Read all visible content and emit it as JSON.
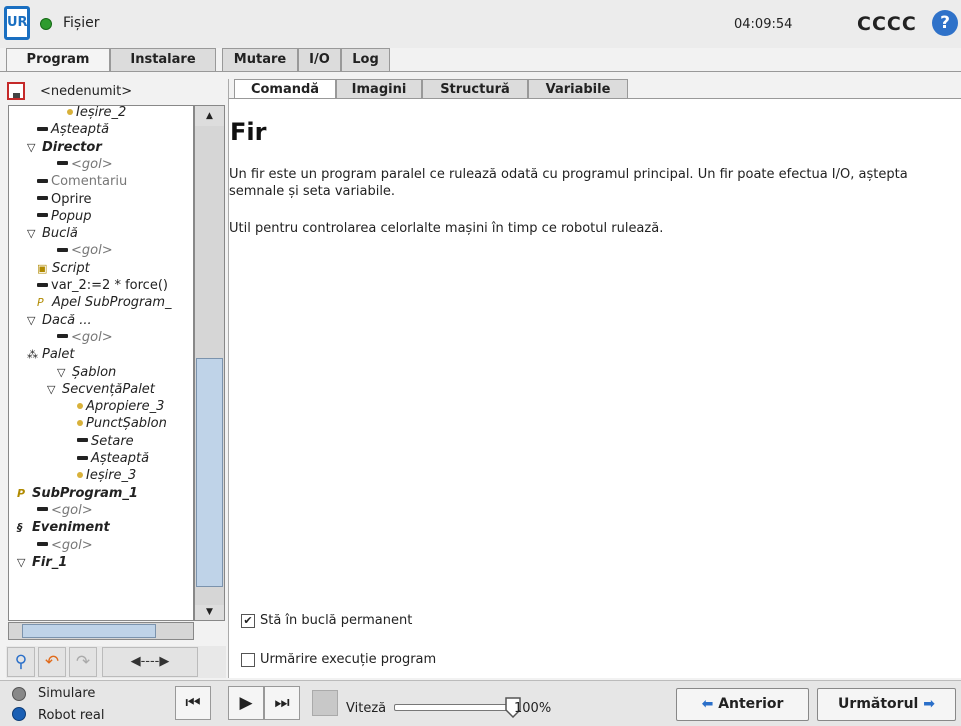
{
  "header": {
    "title": "Fișier",
    "clock": "04:09:54",
    "robot_name": "CCCC",
    "logo": "UR",
    "help": "?"
  },
  "main_tabs": [
    "Program",
    "Instalare",
    "Mutare",
    "I/O",
    "Log"
  ],
  "document": {
    "name": "<nedenumit>"
  },
  "tree": [
    {
      "label": "Ieșire_2",
      "icon": "dot",
      "indent": 4,
      "style": "it"
    },
    {
      "label": "Așteaptă",
      "icon": "bar",
      "indent": 1,
      "style": "it"
    },
    {
      "label": "Director",
      "icon": "tri",
      "indent": 0,
      "style": "bold"
    },
    {
      "label": "<gol>",
      "icon": "bar",
      "indent": 3,
      "style": "gray it"
    },
    {
      "label": "Comentariu",
      "icon": "bar",
      "indent": 1,
      "style": "gray"
    },
    {
      "label": "Oprire",
      "icon": "bar",
      "indent": 1,
      "style": ""
    },
    {
      "label": "Popup",
      "icon": "bar",
      "indent": 1,
      "style": "it"
    },
    {
      "label": "Buclă",
      "icon": "tri",
      "indent": 0,
      "style": "it"
    },
    {
      "label": "<gol>",
      "icon": "bar",
      "indent": 3,
      "style": "gray it"
    },
    {
      "label": "Script",
      "icon": "script",
      "indent": 1,
      "style": "it"
    },
    {
      "label": "var_2:=2 * force()",
      "icon": "bar",
      "indent": 1,
      "style": ""
    },
    {
      "label": "Apel SubProgram_",
      "icon": "sub",
      "indent": 1,
      "style": "it"
    },
    {
      "label": "Dacă ...",
      "icon": "tri",
      "indent": 0,
      "style": "it"
    },
    {
      "label": "<gol>",
      "icon": "bar",
      "indent": 3,
      "style": "gray it"
    },
    {
      "label": "Palet",
      "icon": "pallet",
      "indent": 0,
      "style": "it"
    },
    {
      "label": "Șablon",
      "icon": "tri",
      "indent": 3,
      "style": "it"
    },
    {
      "label": "SecvențăPalet",
      "icon": "tri",
      "indent": 2,
      "style": "it"
    },
    {
      "label": "Apropiere_3",
      "icon": "dot",
      "indent": 5,
      "style": "it"
    },
    {
      "label": "PunctȘablon",
      "icon": "dot",
      "indent": 5,
      "style": "it"
    },
    {
      "label": "Setare",
      "icon": "bar",
      "indent": 5,
      "style": "it"
    },
    {
      "label": "Așteaptă",
      "icon": "bar",
      "indent": 5,
      "style": "it"
    },
    {
      "label": "Ieșire_3",
      "icon": "dot",
      "indent": 5,
      "style": "it"
    },
    {
      "label": "SubProgram_1",
      "icon": "sub",
      "indent": -1,
      "style": "bold"
    },
    {
      "label": "<gol>",
      "icon": "bar",
      "indent": 1,
      "style": "gray it"
    },
    {
      "label": "Eveniment",
      "icon": "event",
      "indent": -1,
      "style": "bold"
    },
    {
      "label": "<gol>",
      "icon": "bar",
      "indent": 1,
      "style": "gray it"
    },
    {
      "label": "Fir_1",
      "icon": "tri",
      "indent": -1,
      "style": "bold"
    }
  ],
  "sub_tabs": [
    "Comandă",
    "Imagini",
    "Structură",
    "Variabile"
  ],
  "node": {
    "title": "Fir",
    "description": "Un fir este un program paralel ce rulează odată cu programul principal. Un fir poate efectua I/O, aștepta semnale și seta variabile.",
    "description2": "Util pentru controlarea celorlalte mașini în timp ce robotul rulează.",
    "loop_label": "Stă în buclă permanent",
    "loop_checked": true,
    "trace_label": "Urmărire execuție program",
    "trace_checked": false
  },
  "status": {
    "sim_label": "Simulare",
    "real_label": "Robot real",
    "speed_label": "Viteză",
    "speed_value": "100%",
    "speed_fraction": 1.0,
    "back_label": "Anterior",
    "next_label": "Următorul"
  }
}
